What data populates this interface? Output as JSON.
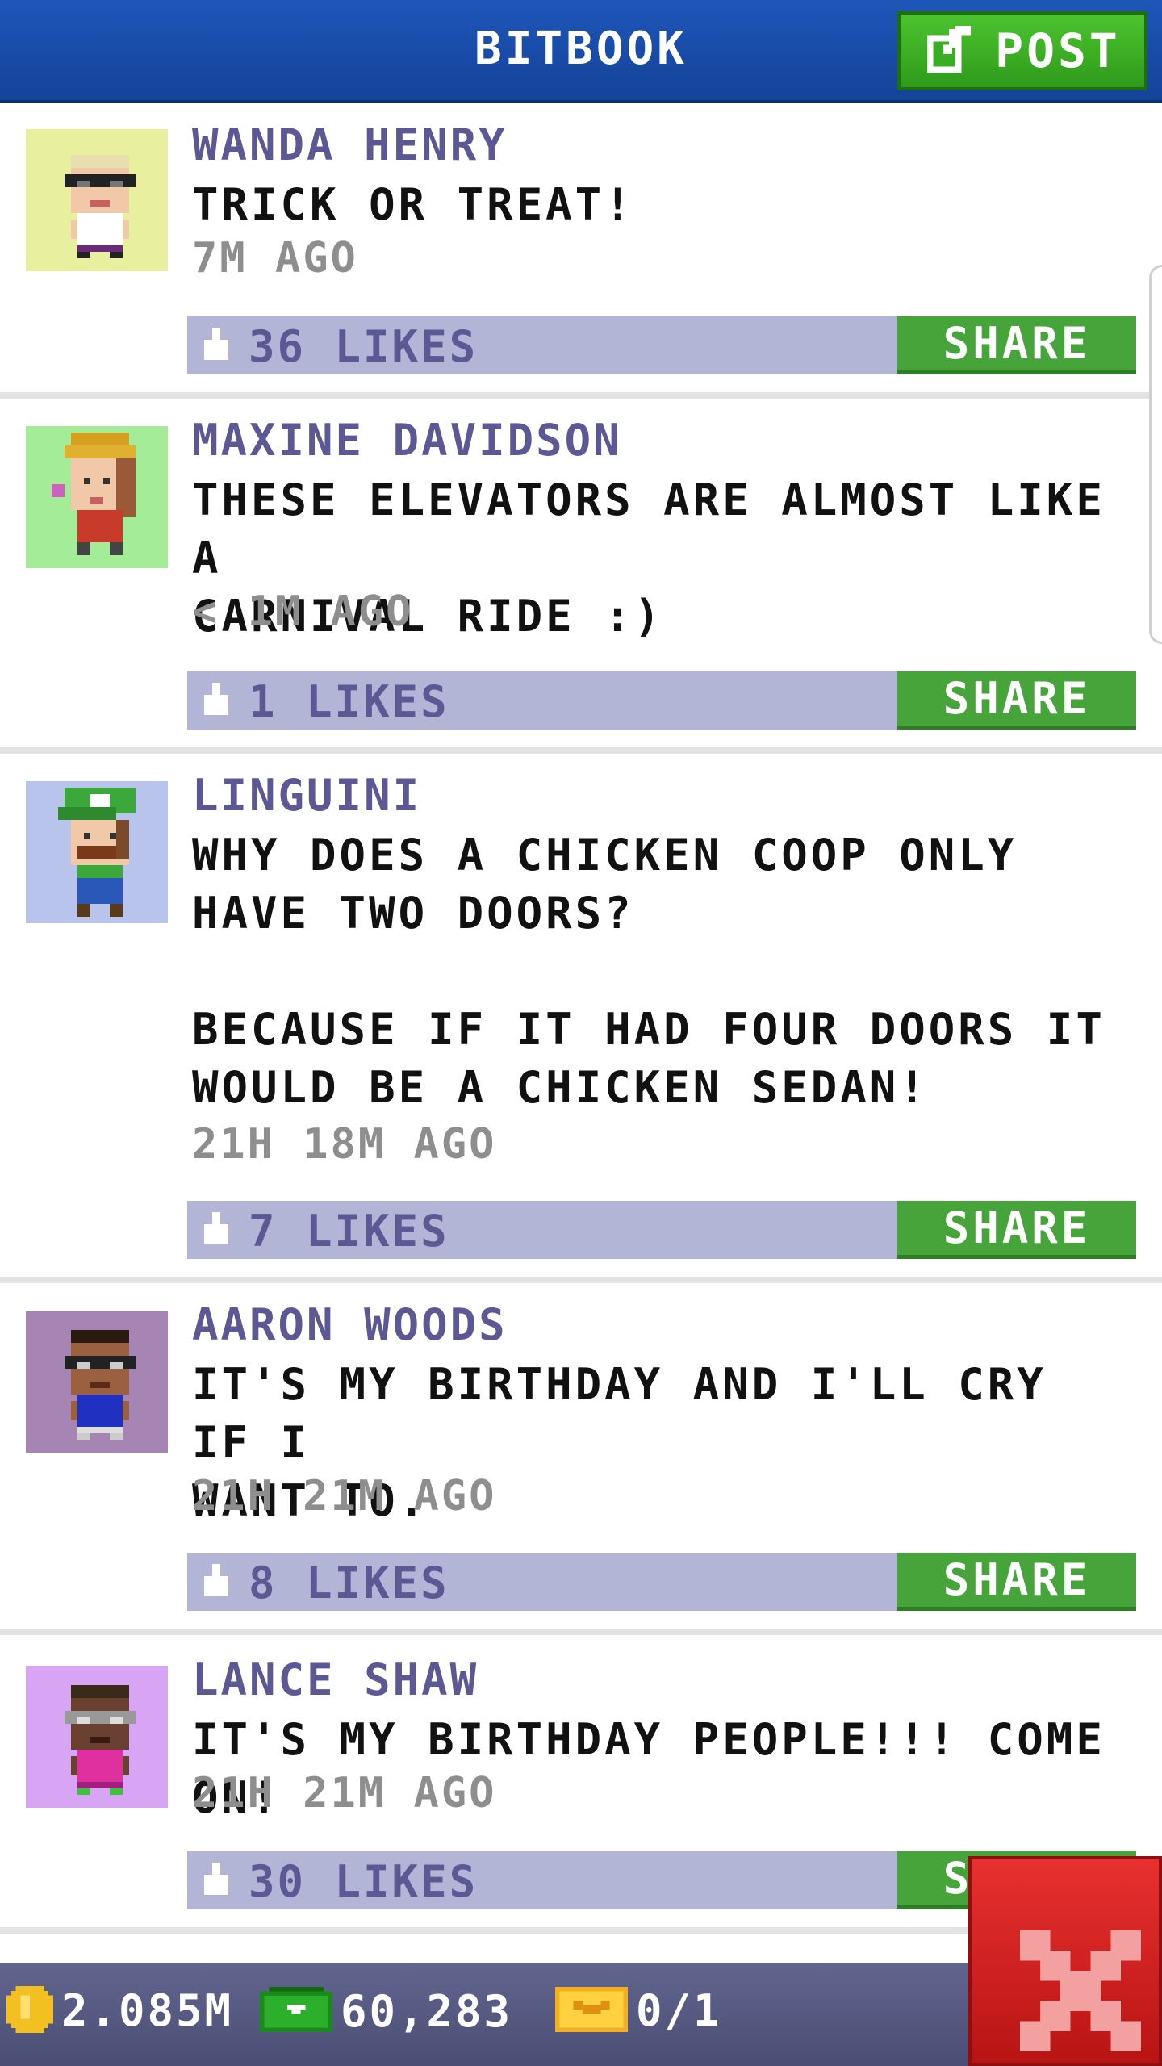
{
  "header": {
    "title": "BITBOOK",
    "post_label": "POST"
  },
  "posts": [
    {
      "author": "WANDA HENRY",
      "message": "TRICK OR TREAT!",
      "time": "7M AGO",
      "likes": "36 LIKES",
      "share_label": "SHARE",
      "avatar_bg": "#e8f0a0"
    },
    {
      "author": "MAXINE DAVIDSON",
      "message": "THESE ELEVATORS ARE ALMOST LIKE A\nCARNIVAL RIDE :)",
      "time": "< 1M AGO",
      "likes": "1 LIKES",
      "share_label": "SHARE",
      "avatar_bg": "#a4ec98"
    },
    {
      "author": "LINGUINI",
      "message": "WHY DOES A CHICKEN COOP ONLY\nHAVE TWO DOORS?\n\nBECAUSE IF IT HAD FOUR DOORS IT\nWOULD BE A CHICKEN SEDAN!",
      "time": "21H 18M AGO",
      "likes": "7 LIKES",
      "share_label": "SHARE",
      "avatar_bg": "#b8c4ec"
    },
    {
      "author": "AARON WOODS",
      "message": "IT'S MY BIRTHDAY AND I'LL CRY IF I\nWANT TO.",
      "time": "21H 21M AGO",
      "likes": "8 LIKES",
      "share_label": "SHARE",
      "avatar_bg": "#a684b4"
    },
    {
      "author": "LANCE SHAW",
      "message": "IT'S MY BIRTHDAY PEOPLE!!! COME ON!",
      "time": "21H 21M AGO",
      "likes": "30 LIKES",
      "share_label": "SHARE",
      "avatar_bg": "#d8a4f4"
    }
  ],
  "bottom_bar": {
    "coins": "2.085M",
    "bux": "60,283",
    "tickets": "0/1"
  },
  "colors": {
    "header_blue": "#1a4fae",
    "accent_green": "#46a43a",
    "author_purple": "#5c5894",
    "likes_bar": "#b2b5d6",
    "close_red": "#d42020"
  },
  "icons": {
    "post": "edit-icon",
    "like": "thumbs-up-icon",
    "coin": "coin-icon",
    "bux": "bux-icon",
    "ticket": "ticket-icon",
    "close": "close-icon"
  }
}
